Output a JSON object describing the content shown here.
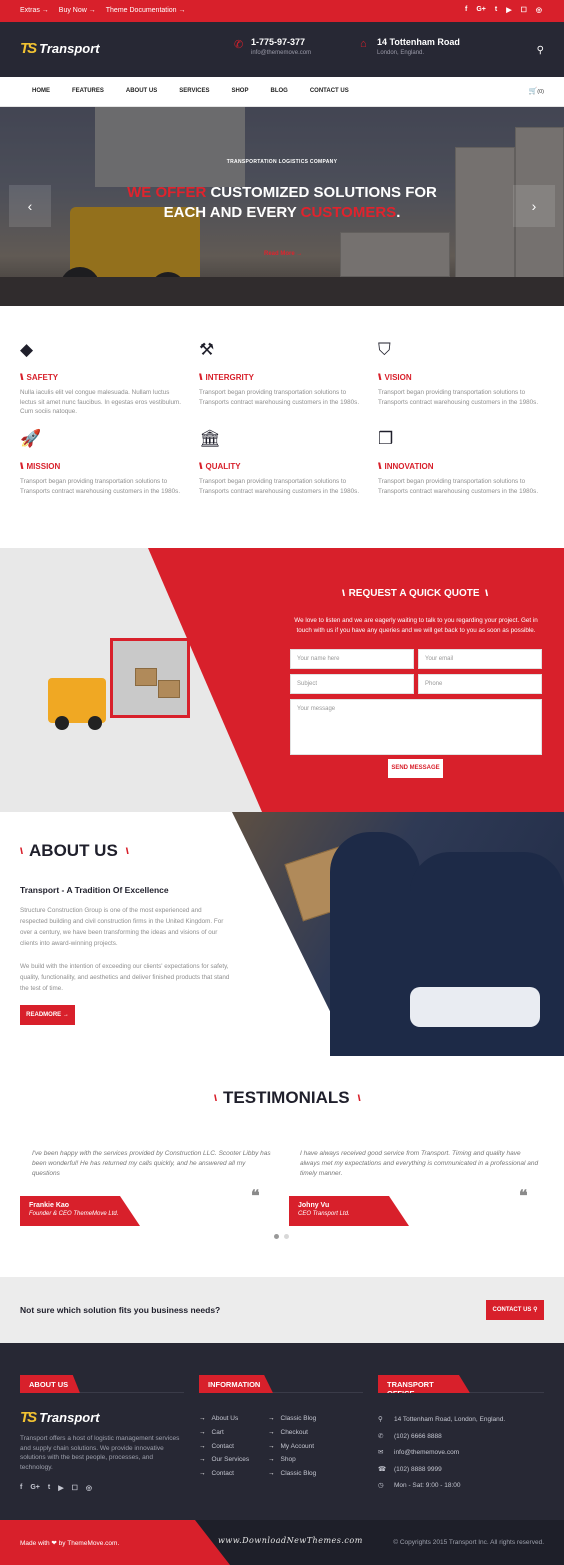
{
  "topbar": {
    "links": [
      "Extras →",
      "Buy Now →",
      "Theme Documentation →"
    ],
    "social": [
      "f",
      "G+",
      "t",
      "▶",
      "☐",
      "◎"
    ]
  },
  "header": {
    "logo_mark": "TS",
    "logo_text": "Transport",
    "phone": "1-775-97-377",
    "email": "info@thememove.com",
    "address": "14 Tottenham Road",
    "city": "London, England."
  },
  "nav": {
    "items": [
      "HOME",
      "FEATURES",
      "ABOUT US",
      "SERVICES",
      "SHOP",
      "BLOG",
      "CONTACT US"
    ],
    "cart": "(0)"
  },
  "hero": {
    "label": "TRANSPORTATION LOGISTICS COMPANY",
    "title_red1": "WE OFFER",
    "title_white1": " CUSTOMIZED SOLUTIONS FOR",
    "title_white2": "EACH AND EVERY ",
    "title_red2": "CUSTOMERS",
    "title_end": ".",
    "more": "Read More →"
  },
  "features": [
    {
      "icon": "dropbox-icon",
      "glyph": "◆",
      "title": "SAFETY",
      "text": "Nulla iaculis elit vel congue malesuada. Nullam luctus lectus sit amet nunc faucibus. In egestas eros vestibulum. Cum sociis natoque."
    },
    {
      "icon": "gavel-icon",
      "glyph": "⚒",
      "title": "INTERGRITY",
      "text": "Transport began providing transportation solutions to Transports contract warehousing customers in the 1980s."
    },
    {
      "icon": "shield-icon",
      "glyph": "⛉",
      "title": "VISION",
      "text": "Transport began providing transportation solutions to Transports contract warehousing customers in the 1980s."
    },
    {
      "icon": "rocket-icon",
      "glyph": "🚀",
      "title": "MISSION",
      "text": "Transport began providing transportation solutions to Transports contract warehousing customers in the 1980s."
    },
    {
      "icon": "bank-icon",
      "glyph": "🏛",
      "title": "QUALITY",
      "text": "Transport began providing transportation solutions to Transports contract warehousing customers in the 1980s."
    },
    {
      "icon": "cubes-icon",
      "glyph": "❒",
      "title": "INNOVATION",
      "text": "Transport began providing transportation solutions to Transports contract warehousing customers in the 1980s."
    }
  ],
  "quote": {
    "title": "REQUEST A QUICK QUOTE",
    "text": "We love to listen and we are eagerly waiting to talk to you regarding your project. Get in touch with us if you have any queries and we will get back to you as soon as possible.",
    "name_ph": "Your name here",
    "email_ph": "Your email",
    "subject_ph": "Subject",
    "phone_ph": "Phone",
    "message_ph": "Your message",
    "send": "SEND MESSAGE"
  },
  "about": {
    "title": "ABOUT US",
    "subtitle": "Transport - A Tradition Of Excellence",
    "p1": "Structure Construction Group is one of the most experienced and respected building and civil construction firms in the United Kingdom. For over a century, we have been transforming the ideas and visions of our clients into award-winning projects.",
    "p2": "We build with the intention of exceeding our clients' expectations for safety, quality, functionality, and aesthetics and deliver finished products that stand the test of time.",
    "button": "READMORE →"
  },
  "testimonials": {
    "title": "TESTIMONIALS",
    "items": [
      {
        "quote": "I've been happy with the services provided by Construction LLC. Scooter Libby has been wonderful! He has returned my calls quickly, and he answered all my questions",
        "name": "Frankie Kao",
        "role": "Founder & CEO ThemeMove Ltd."
      },
      {
        "quote": "I have always received good service from Transport. Timing and quality have always met my expectations and everything is communicated in a professional and timely manner.",
        "name": "Johny Vu",
        "role": "CEO Transport Ltd."
      }
    ]
  },
  "cta": {
    "text": "Not sure which solution fits you business needs?",
    "button": "CONTACT US ⚲"
  },
  "footer": {
    "about_head": "ABOUT US",
    "info_head": "INFORMATION",
    "office_head": "TRANSPORT OFFICE",
    "logo_mark": "TS",
    "logo_text": "Transport",
    "about_text": "Transport offers a host of logistic management services and supply chain solutions. We provide innovative solutions with the best people, processes, and technology.",
    "social": [
      "f",
      "G+",
      "t",
      "▶",
      "☐",
      "◎"
    ],
    "info_col1": [
      "About Us",
      "Cart",
      "Contact",
      "Our Services",
      "Contact"
    ],
    "info_col2": [
      "Classic Blog",
      "Checkout",
      "My Account",
      "Shop",
      "Classic Blog"
    ],
    "office": [
      "14 Tottenham Road, London, England.",
      "(102) 6666 8888",
      "info@thememove.com",
      "(102) 8888 9999",
      "Mon - Sat: 9:00 - 18:00"
    ],
    "made_with": "Made with ❤ by ThemeMove.com.",
    "watermark": "www.DownloadNewThemes.com",
    "copyright": "© Copyrights 2015 Transport Inc. All rights reserved."
  }
}
